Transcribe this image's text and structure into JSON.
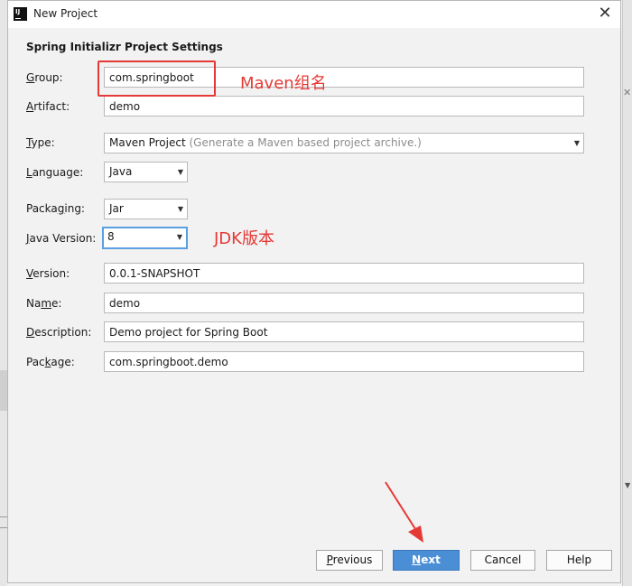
{
  "dialog": {
    "title": "New Project"
  },
  "heading": "Spring Initializr Project Settings",
  "fields": {
    "group": {
      "label_pre": "",
      "label_u": "G",
      "label_post": "roup:",
      "value": "com.springboot"
    },
    "artifact": {
      "label_pre": "",
      "label_u": "A",
      "label_post": "rtifact:",
      "value": "demo"
    },
    "type": {
      "label_pre": "",
      "label_u": "T",
      "label_post": "ype:",
      "value": "Maven Project",
      "hint": "(Generate a Maven based project archive.)"
    },
    "language": {
      "label_pre": "",
      "label_u": "L",
      "label_post": "anguage:",
      "value": "Java"
    },
    "packaging": {
      "label_pre": "Packa",
      "label_u": "g",
      "label_post": "ing:",
      "value": "Jar"
    },
    "java_version": {
      "label_pre": "",
      "label_u": "J",
      "label_post": "ava Version:",
      "value": "8"
    },
    "version": {
      "label_pre": "",
      "label_u": "V",
      "label_post": "ersion:",
      "value": "0.0.1-SNAPSHOT"
    },
    "name": {
      "label_pre": "Na",
      "label_u": "m",
      "label_post": "e:",
      "value": "demo"
    },
    "description": {
      "label_pre": "",
      "label_u": "D",
      "label_post": "escription:",
      "value": "Demo project for Spring Boot"
    },
    "package": {
      "label_pre": "Pac",
      "label_u": "k",
      "label_post": "age:",
      "value": "com.springboot.demo"
    }
  },
  "annotations": {
    "maven": "Maven组名",
    "jdk": "JDK版本",
    "color": "#e53935"
  },
  "buttons": {
    "previous": {
      "u": "P",
      "rest": "revious"
    },
    "next": {
      "u": "N",
      "rest": "ext"
    },
    "cancel": "Cancel",
    "help": "Help"
  },
  "icons": {
    "app": "intellij-icon",
    "close": "close-icon",
    "dropdown": "chevron-down-icon"
  }
}
